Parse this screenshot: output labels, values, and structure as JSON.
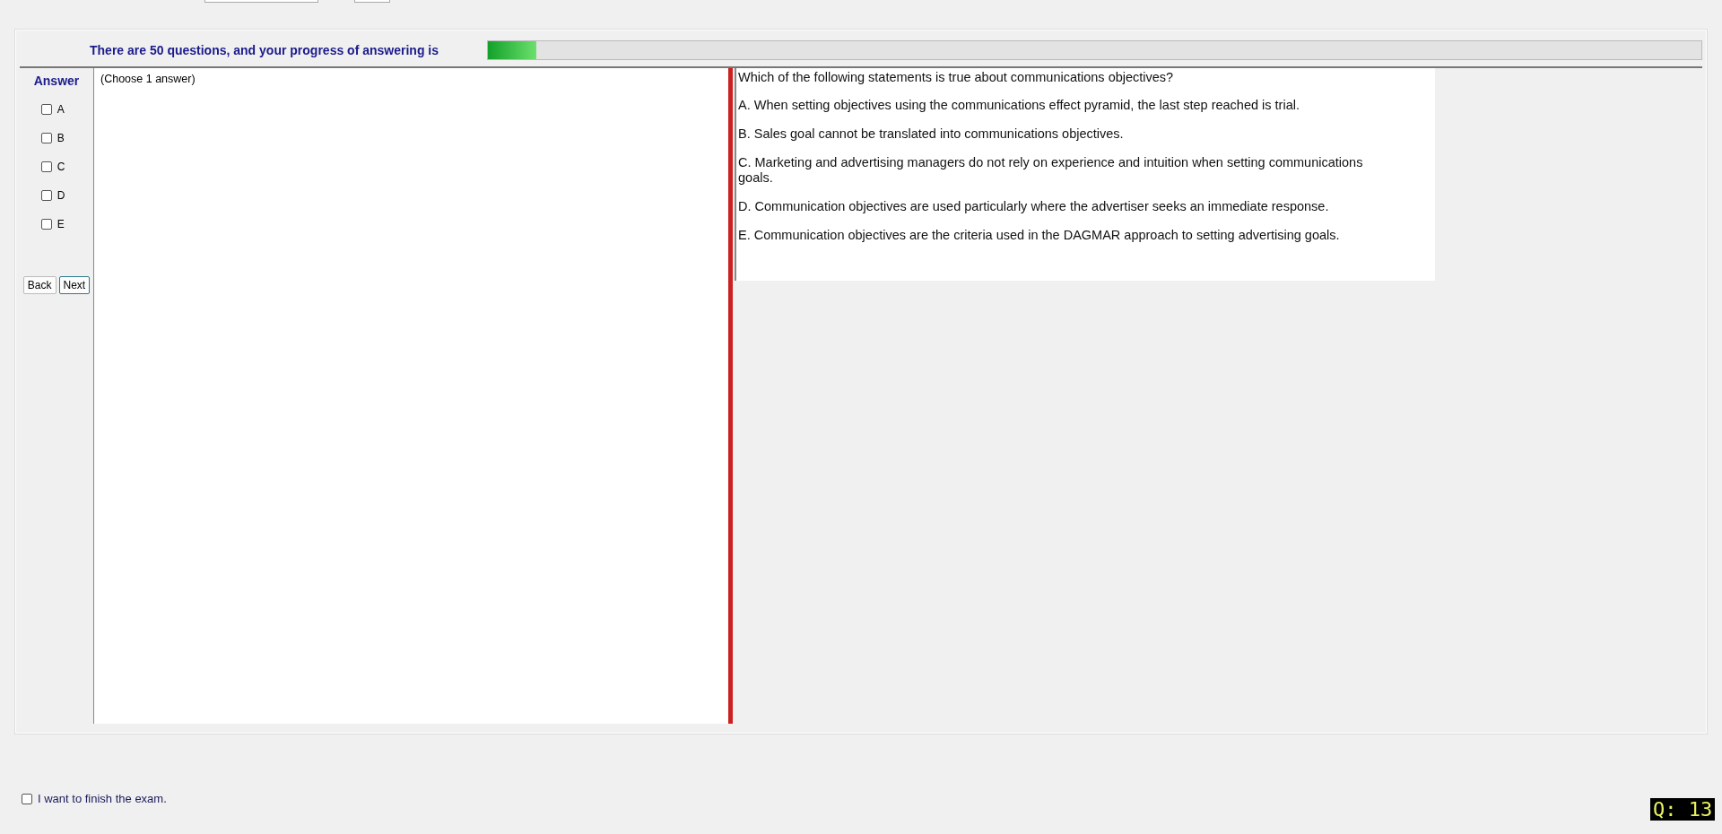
{
  "progress": {
    "label": "There are 50 questions, and your progress of answering is",
    "level": 0.04
  },
  "answer_panel": {
    "title": "Answer",
    "options": [
      {
        "label": "A",
        "checked": false
      },
      {
        "label": "B",
        "checked": false
      },
      {
        "label": "C",
        "checked": false
      },
      {
        "label": "D",
        "checked": false
      },
      {
        "label": "E",
        "checked": false
      }
    ],
    "buttons": [
      {
        "label": "Back",
        "focused": false
      },
      {
        "label": "Next",
        "focused": true
      }
    ]
  },
  "answer_box": {
    "hint": "(Choose 1 answer)"
  },
  "question": {
    "text": "Which of the following statements is true about communications objectives?",
    "choices": [
      "A.  When setting objectives using the communications effect pyramid, the last step reached is trial.",
      "B.  Sales goal cannot be translated into communications objectives.",
      "C.  Marketing and advertising managers do not rely on experience and intuition when setting communications goals.",
      "D.  Communication objectives are used particularly where the advertiser seeks an immediate response.",
      "E.  Communication objectives are the criteria used in the DAGMAR approach to setting advertising goals."
    ]
  },
  "finish": {
    "label": "I want to finish the exam.",
    "checked": false
  },
  "question_number": "Q: 13"
}
